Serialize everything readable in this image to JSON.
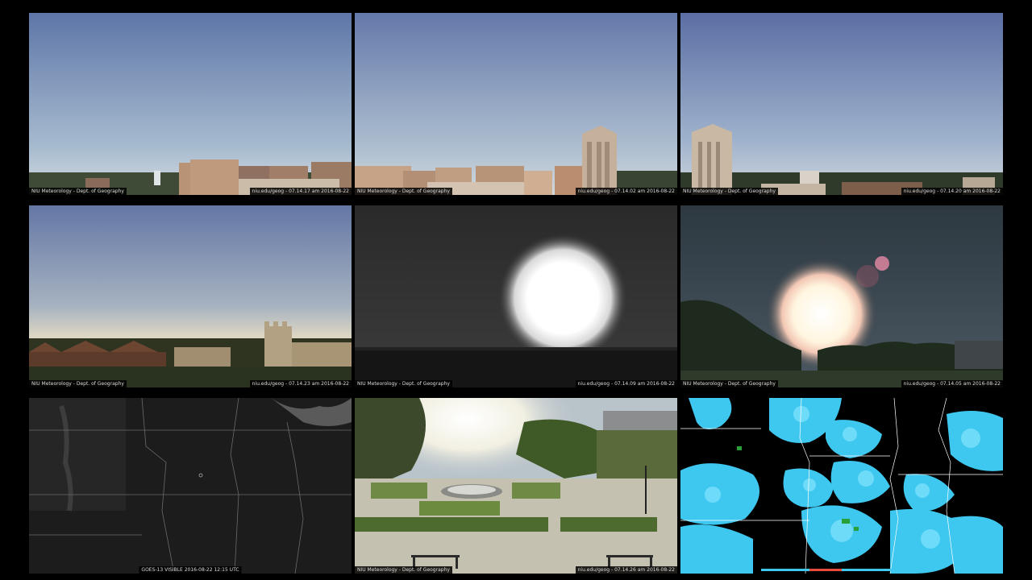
{
  "tiles": [
    {
      "id": "cam-sky-1",
      "caption_left": "NIU Meteorology - Dept. of Geography",
      "caption_right": "niu.edu/geog - 07.14.17 am 2016-08-22"
    },
    {
      "id": "cam-sky-2",
      "caption_left": "NIU Meteorology - Dept. of Geography",
      "caption_right": "niu.edu/geog - 07.14.02 am 2016-08-22"
    },
    {
      "id": "cam-sky-3",
      "caption_left": "NIU Meteorology - Dept. of Geography",
      "caption_right": "niu.edu/geog - 07.14.20 am 2016-08-22"
    },
    {
      "id": "cam-campus-sky",
      "caption_left": "NIU Meteorology - Dept. of Geography",
      "caption_right": "niu.edu/geog - 07.14.23 am 2016-08-22"
    },
    {
      "id": "cam-sun-mono",
      "caption_left": "NIU Meteorology - Dept. of Geography",
      "caption_right": "niu.edu/geog - 07.14.09 am 2016-08-22"
    },
    {
      "id": "cam-sun-trees",
      "caption_left": "NIU Meteorology - Dept. of Geography",
      "caption_right": "niu.edu/geog - 07.14.05 am 2016-08-22"
    },
    {
      "id": "satellite-image",
      "caption_center": "GOES-13 VISIBLE 2016-08-22 12:15 UTC"
    },
    {
      "id": "cam-plaza",
      "caption_left": "NIU Meteorology - Dept. of Geography",
      "caption_right": "niu.edu/geog - 07.14.26 am 2016-08-22"
    },
    {
      "id": "radar-map",
      "caption_center": ""
    }
  ],
  "colors": {
    "sky_top": "#6a82b0",
    "sky_bottom": "#c9d6e4",
    "radar_echo": "#3ec8f0",
    "radar_light": "#8ee8ff",
    "satellite_bg": "#1c1c1c",
    "brick": "#b38a6e"
  },
  "icons": [
    "camera-feed",
    "satellite-feed",
    "radar-feed"
  ]
}
